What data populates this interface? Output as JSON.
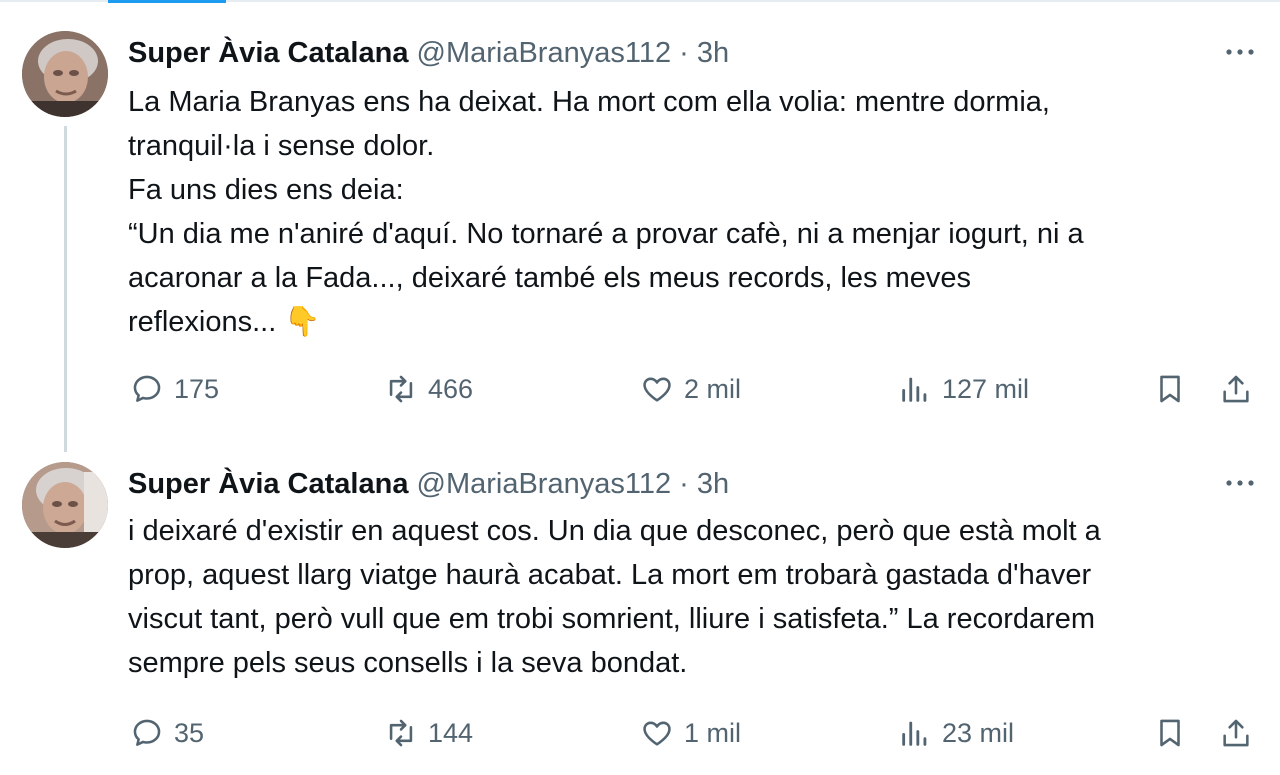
{
  "tweets": [
    {
      "author_name": "Super Àvia Catalana",
      "handle": "@MariaBranyas112",
      "separator": "·",
      "time": "3h",
      "text_lines": [
        "La Maria Branyas ens ha deixat. Ha mort com ella volia: mentre dormia,",
        "tranquil·la i sense dolor.",
        "Fa uns dies ens deia:",
        "“Un dia me n'aniré d'aquí. No tornaré a provar cafè, ni a menjar iogurt, ni a",
        "acaronar a la Fada..., deixaré també els meus records, les meves",
        "reflexions... 👇"
      ],
      "replies": "175",
      "retweets": "466",
      "likes": "2 mil",
      "views": "127 mil"
    },
    {
      "author_name": "Super Àvia Catalana",
      "handle": "@MariaBranyas112",
      "separator": "·",
      "time": "3h",
      "text_lines": [
        "i deixaré d'existir en aquest cos. Un dia que desconec, però que està molt a",
        "prop, aquest llarg viatge haurà acabat. La mort em trobarà gastada d'haver",
        "viscut tant, però vull que em trobi somrient, lliure i satisfeta.” La recordarem",
        "sempre pels seus consells i la seva bondat."
      ],
      "replies": "35",
      "retweets": "144",
      "likes": "1 mil",
      "views": "23 mil"
    }
  ],
  "colors": {
    "text": "#0f1419",
    "secondary": "#536471",
    "accent": "#1d9bf0",
    "thread_line": "#cfd9de"
  },
  "icons": [
    "more-icon",
    "reply-icon",
    "retweet-icon",
    "like-icon",
    "views-icon",
    "bookmark-icon",
    "share-icon"
  ]
}
